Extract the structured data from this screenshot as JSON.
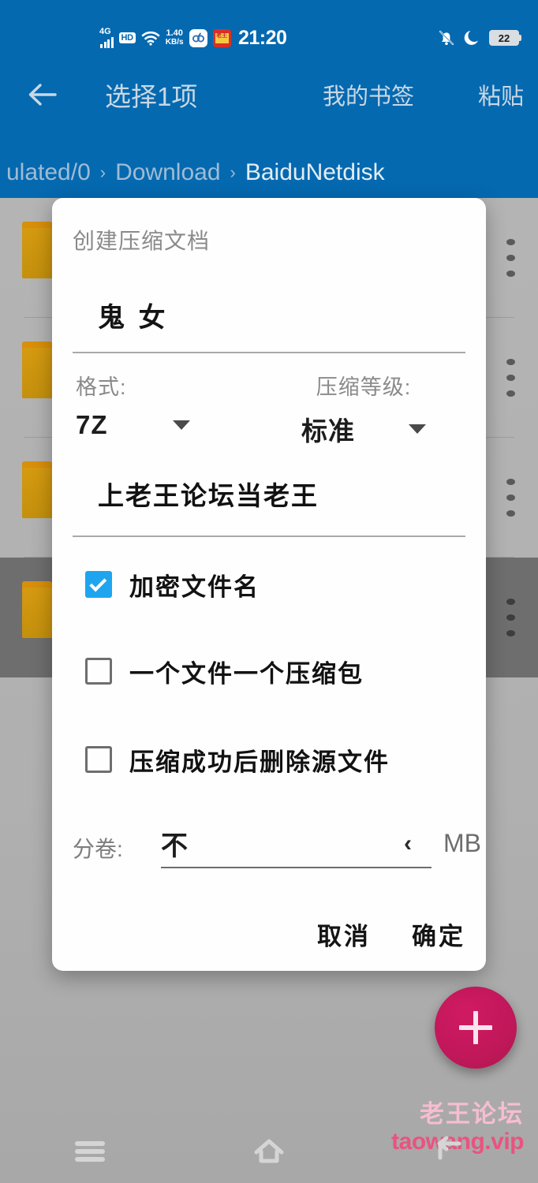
{
  "statusbar": {
    "network_label": "4G",
    "hd_label": "HD",
    "speed_value": "1.40",
    "speed_unit": "KB/s",
    "clock": "21:20",
    "battery_percent": "22",
    "icons": [
      "signal-bars-icon",
      "hd-icon",
      "wifi-icon",
      "network-speed-icon",
      "app-badge-icon",
      "app-badge-red-icon",
      "notifications-muted-icon",
      "do-not-disturb-moon-icon",
      "battery-icon"
    ]
  },
  "appbar": {
    "back_label": "←",
    "title": "选择1项",
    "bookmark_label": "我的书签",
    "paste_label": "粘贴",
    "background_color": "#0569b0"
  },
  "breadcrumb": {
    "separator": "›",
    "items": [
      "ulated/0",
      "Download",
      "BaiduNetdisk"
    ]
  },
  "filelist": {
    "rows": [
      {
        "name": "folder-row-1",
        "selected": false
      },
      {
        "name": "folder-row-2",
        "selected": false
      },
      {
        "name": "folder-row-3",
        "selected": false
      },
      {
        "name": "folder-row-4",
        "selected": true
      }
    ],
    "folder_color": "#c4900d",
    "selected_row_color": "#6e6e6e"
  },
  "fab": {
    "icon": "plus-icon",
    "label": "+",
    "color": "#c2185b"
  },
  "watermark": {
    "cn": "老王论坛",
    "en": "taowang.vip",
    "cn_color": "#f6bdd0",
    "en_color": "#e9537f"
  },
  "navbar": {
    "recents_label": "recents-icon",
    "home_label": "home-icon",
    "back_label": "back-icon"
  },
  "dialog": {
    "title": "创建压缩文档",
    "filename_value": "鬼 女",
    "format": {
      "label": "格式:",
      "value": "7Z"
    },
    "level": {
      "label": "压缩等级:",
      "value": "标准"
    },
    "password_value": "上老王论坛当老王",
    "checkboxes": [
      {
        "label": "加密文件名",
        "checked": true
      },
      {
        "label": "一个文件一个压缩包",
        "checked": false
      },
      {
        "label": "压缩成功后删除源文件",
        "checked": false
      }
    ],
    "split": {
      "label": "分卷:",
      "value": "不",
      "chevron": "‹",
      "unit": "MB"
    },
    "cancel_label": "取消",
    "confirm_label": "确定",
    "checkbox_accent": "#1fa5f0"
  }
}
